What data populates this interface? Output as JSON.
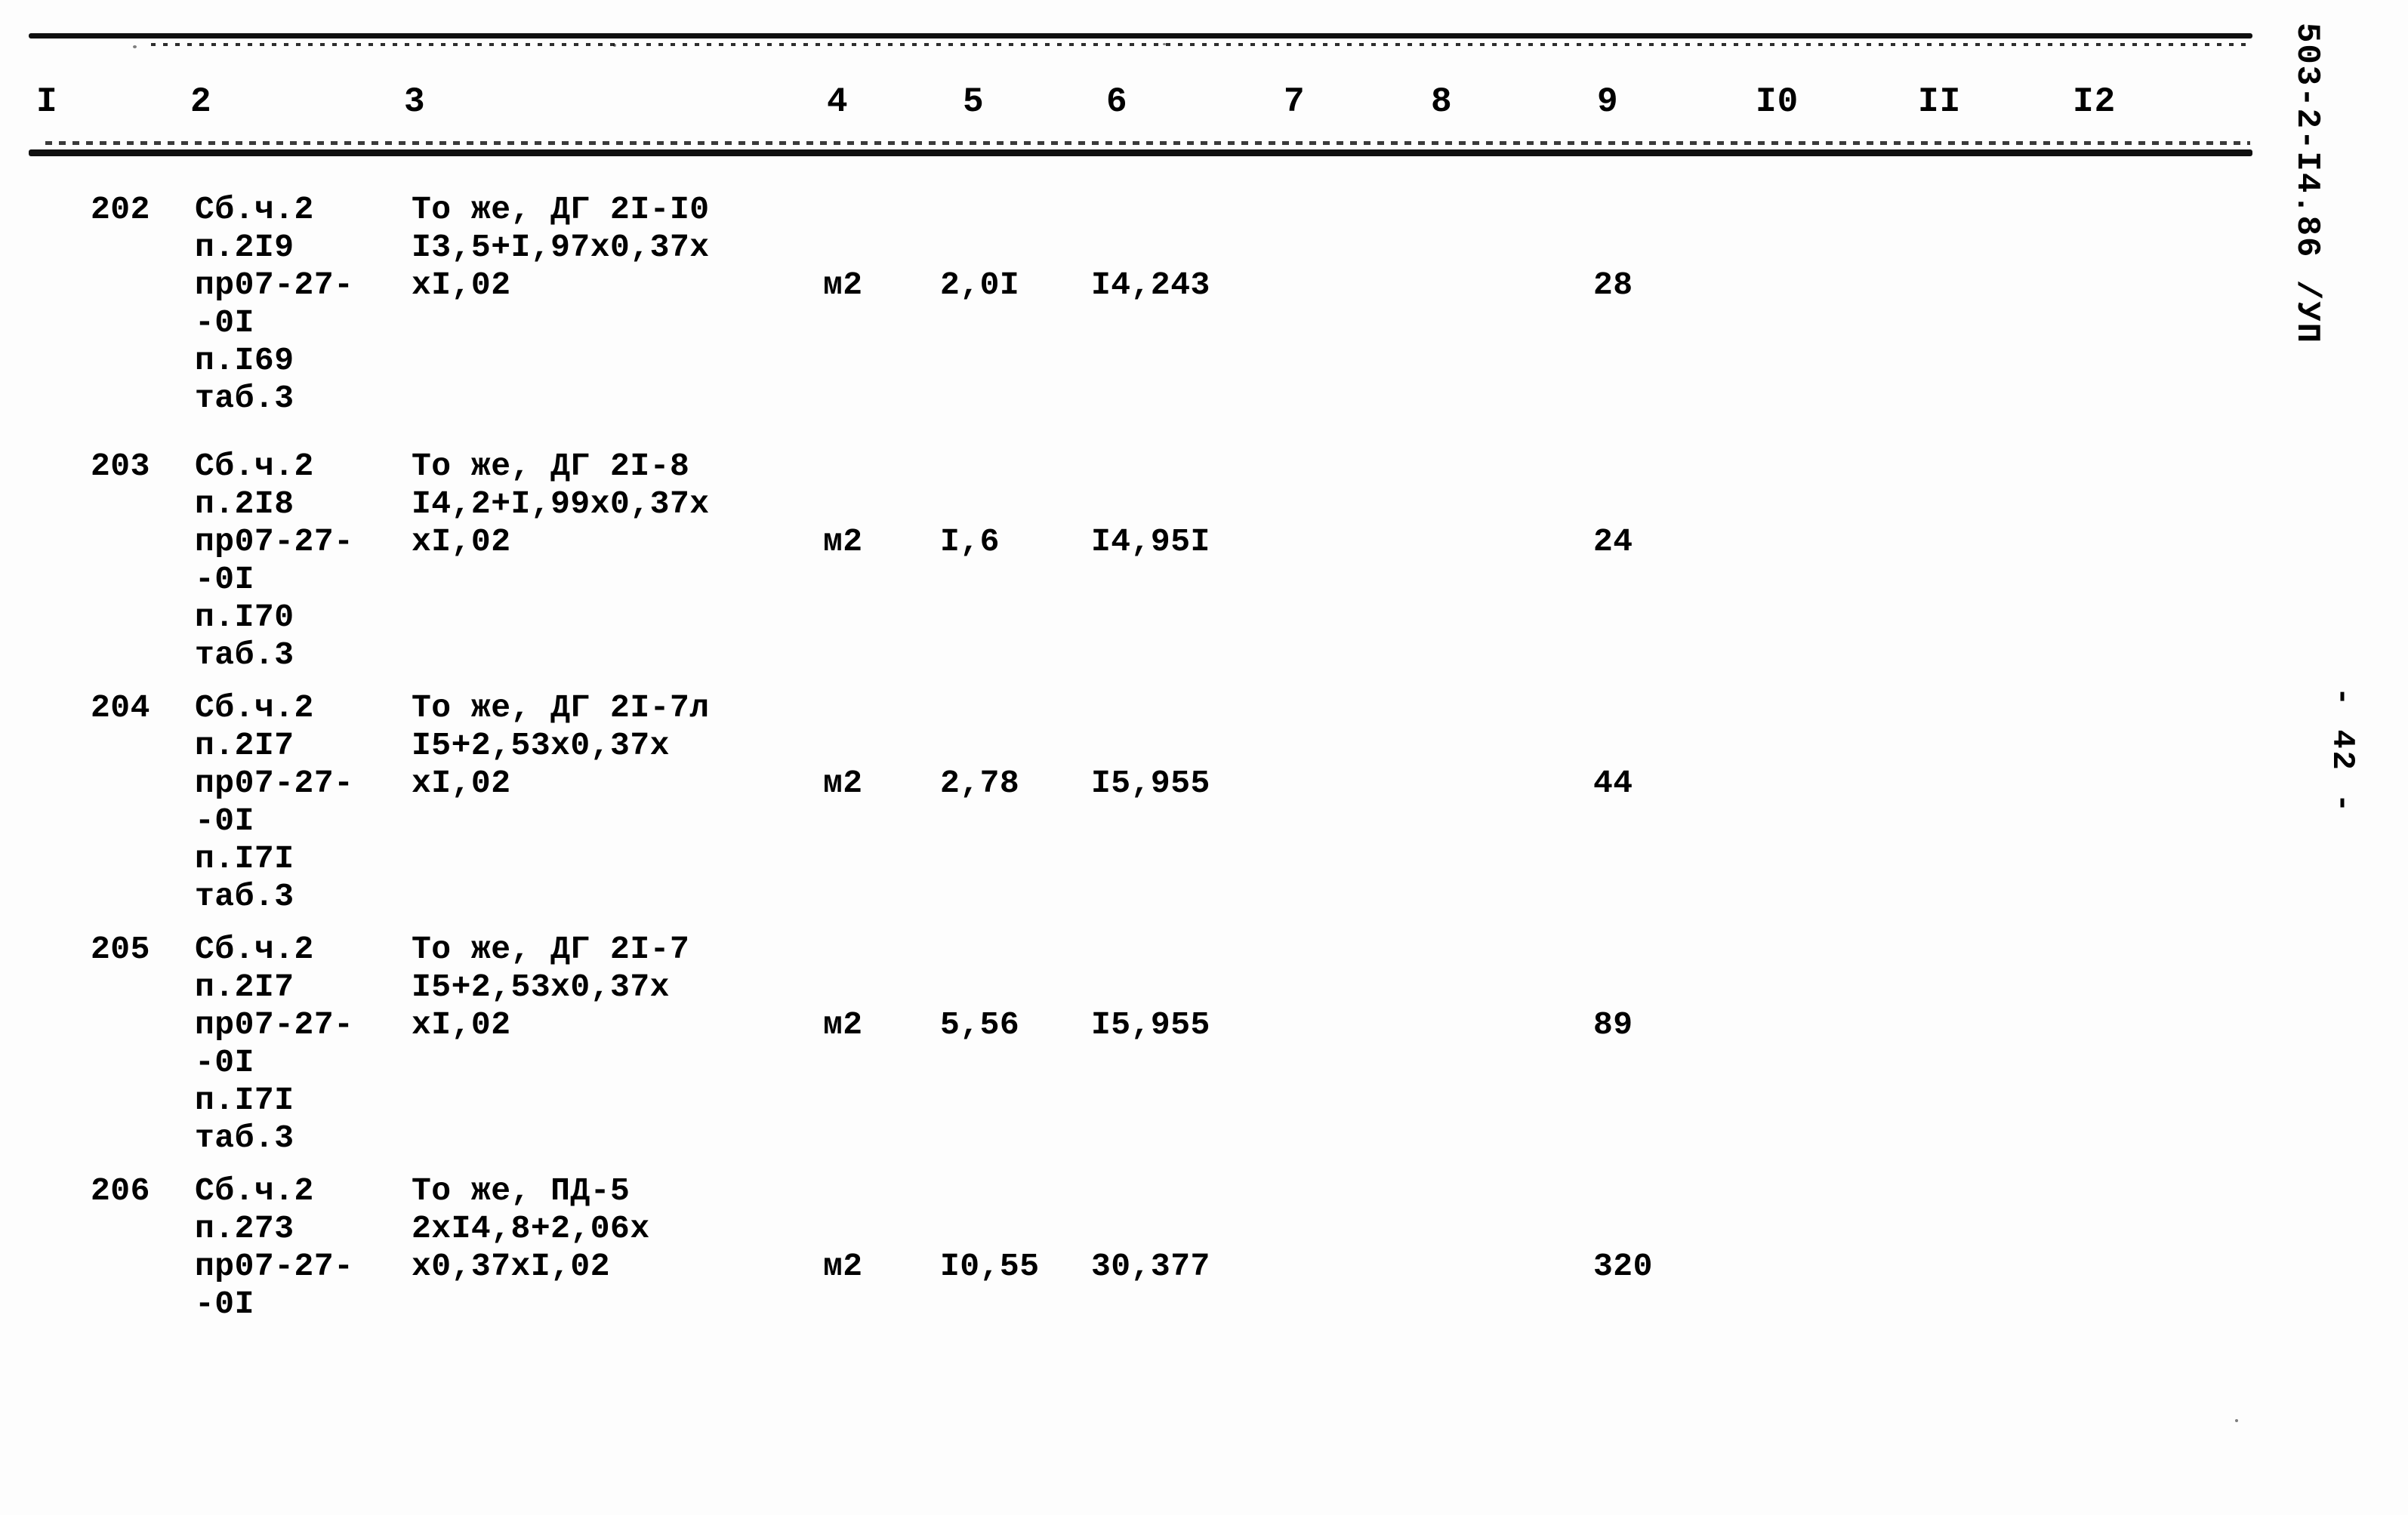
{
  "document": {
    "margin_code": "503-2-I4.86 /УП",
    "page_number": "- 42 -"
  },
  "table": {
    "headers": [
      "I",
      "2",
      "3",
      "4",
      "5",
      "6",
      "7",
      "8",
      "9",
      "I0",
      "II",
      "I2"
    ],
    "rows": [
      {
        "num": "202",
        "source": "Сб.ч.2\nп.2I9\nпр07-27-\n-0I\nп.I69\nтаб.3",
        "description": "То же, ДГ 2I-I0\nI3,5+I,97х0,37х\nхI,02",
        "unit": "м2",
        "qty": "2,0I",
        "mass": "I4,243",
        "c7": "",
        "c8": "",
        "c9": "28",
        "c10": "",
        "c11": "",
        "c12": ""
      },
      {
        "num": "203",
        "source": "Сб.ч.2\nп.2I8\nпр07-27-\n-0I\nп.I70\nтаб.3",
        "description": "То же, ДГ 2I-8\nI4,2+I,99х0,37х\nхI,02",
        "unit": "м2",
        "qty": "I,6",
        "mass": "I4,95I",
        "c7": "",
        "c8": "",
        "c9": "24",
        "c10": "",
        "c11": "",
        "c12": ""
      },
      {
        "num": "204",
        "source": "Сб.ч.2\nп.2I7\nпр07-27-\n-0I\nп.I7I\nтаб.3",
        "description": "То же, ДГ 2I-7л\nI5+2,53х0,37х\nхI,02",
        "unit": "м2",
        "qty": "2,78",
        "mass": "I5,955",
        "c7": "",
        "c8": "",
        "c9": "44",
        "c10": "",
        "c11": "",
        "c12": ""
      },
      {
        "num": "205",
        "source": "Сб.ч.2\nп.2I7\nпр07-27-\n-0I\nп.I7I\nтаб.3",
        "description": "То же, ДГ 2I-7\nI5+2,53х0,37х\nхI,02",
        "unit": "м2",
        "qty": "5,56",
        "mass": "I5,955",
        "c7": "",
        "c8": "",
        "c9": "89",
        "c10": "",
        "c11": "",
        "c12": ""
      },
      {
        "num": "206",
        "source": "Сб.ч.2\nп.273\nпр07-27-\n-0I",
        "description": "То же, ПД-5\n2хI4,8+2,06х\nх0,37хI,02",
        "unit": "м2",
        "qty": "I0,55",
        "mass": "30,377",
        "c7": "",
        "c8": "",
        "c9": "320",
        "c10": "",
        "c11": "",
        "c12": ""
      }
    ]
  }
}
